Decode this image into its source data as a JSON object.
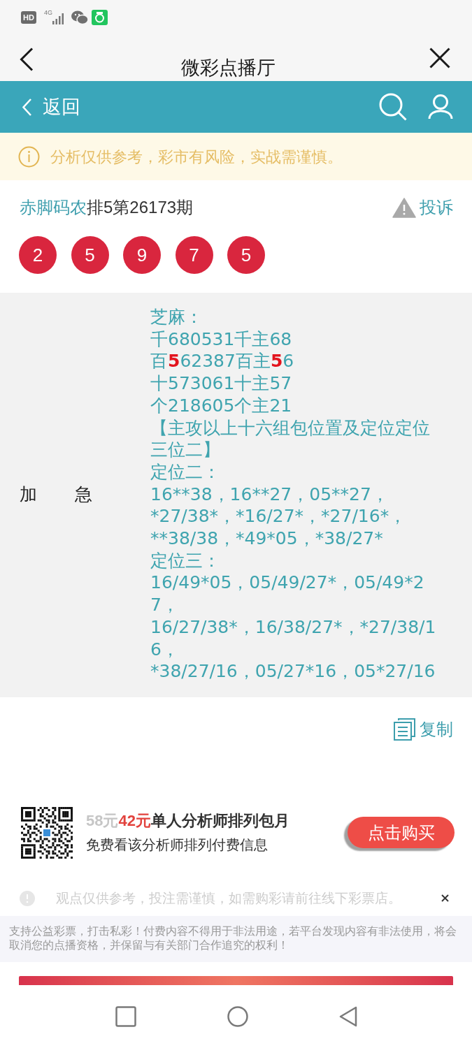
{
  "status_bar": {
    "hd_badge": "HD",
    "network_type": "4G"
  },
  "window": {
    "title": "微彩点播厅"
  },
  "header": {
    "back_label": "返回"
  },
  "notice": {
    "text": "分析仅供参考，彩市有风险，实战需谨慎。"
  },
  "post": {
    "author": "赤脚码农",
    "issue": "排5第26173期",
    "complaint": "投诉",
    "balls": [
      "2",
      "5",
      "9",
      "7",
      "5"
    ]
  },
  "content": {
    "label": "加 急",
    "lines": [
      {
        "segments": [
          {
            "text": "芝麻：",
            "highlight": false
          }
        ]
      },
      {
        "segments": [
          {
            "text": "千680531千主68",
            "highlight": false
          }
        ]
      },
      {
        "segments": [
          {
            "text": "百",
            "highlight": false
          },
          {
            "text": "5",
            "highlight": true
          },
          {
            "text": "62387百主",
            "highlight": false
          },
          {
            "text": "5",
            "highlight": true
          },
          {
            "text": "6",
            "highlight": false
          }
        ]
      },
      {
        "segments": [
          {
            "text": "十573061十主57",
            "highlight": false
          }
        ]
      },
      {
        "segments": [
          {
            "text": "个218605个主21",
            "highlight": false
          }
        ]
      },
      {
        "segments": [
          {
            "text": "【主攻以上十六组包位置及定位定位三位二】",
            "highlight": false
          }
        ]
      },
      {
        "segments": [
          {
            "text": "定位二：",
            "highlight": false
          }
        ]
      },
      {
        "segments": [
          {
            "text": "16**38，16**27，05**27，",
            "highlight": false
          }
        ]
      },
      {
        "segments": [
          {
            "text": "*27/38*，*16/27*，*27/16*，",
            "highlight": false
          }
        ]
      },
      {
        "segments": [
          {
            "text": "**38/38，*49*05，*38/27*",
            "highlight": false
          }
        ]
      },
      {
        "segments": [
          {
            "text": "定位三：",
            "highlight": false
          }
        ]
      },
      {
        "segments": [
          {
            "text": "16/49*05，05/49/27*，05/49*27，",
            "highlight": false
          }
        ]
      },
      {
        "segments": [
          {
            "text": "16/27/38*，16/38/27*，*27/38/16，",
            "highlight": false
          }
        ]
      },
      {
        "segments": [
          {
            "text": "*38/27/16，05/27*16，05*27/16",
            "highlight": false
          }
        ]
      }
    ]
  },
  "copy_button": {
    "label": "复制"
  },
  "promo": {
    "original_price": "58元",
    "price": "42元",
    "title": "单人分析师排列包月",
    "subtitle": "免费看该分析师排列付费信息",
    "buy_button": "点击购买"
  },
  "disclaimer": {
    "text": "观点仅供参考，投注需谨慎，如需购彩请前往线下彩票店。"
  },
  "legal_notice": "支持公益彩票，打击私彩！付费内容不得用于非法用途，若平台发现内容有非法使用，将会取消您的点播资格，并保留与有关部门合作追究的权利！"
}
